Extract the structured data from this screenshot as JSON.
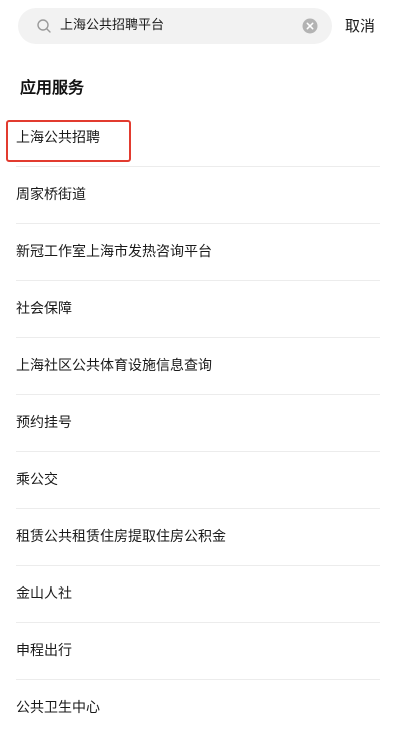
{
  "search": {
    "value": "上海公共招聘平台",
    "icon": "search-icon",
    "clear_icon": "clear-icon"
  },
  "cancel_label": "取消",
  "section": {
    "title": "应用服务"
  },
  "items": [
    {
      "label": "上海公共招聘",
      "highlighted": true
    },
    {
      "label": "周家桥街道"
    },
    {
      "label": "新冠工作室上海市发热咨询平台"
    },
    {
      "label": "社会保障"
    },
    {
      "label": "上海社区公共体育设施信息查询"
    },
    {
      "label": "预约挂号"
    },
    {
      "label": "乘公交"
    },
    {
      "label": "租赁公共租赁住房提取住房公积金"
    },
    {
      "label": "金山人社"
    },
    {
      "label": "申程出行"
    },
    {
      "label": "公共卫生中心"
    }
  ],
  "colors": {
    "highlight": "#e23b2f",
    "search_bg": "#f2f2f2"
  }
}
